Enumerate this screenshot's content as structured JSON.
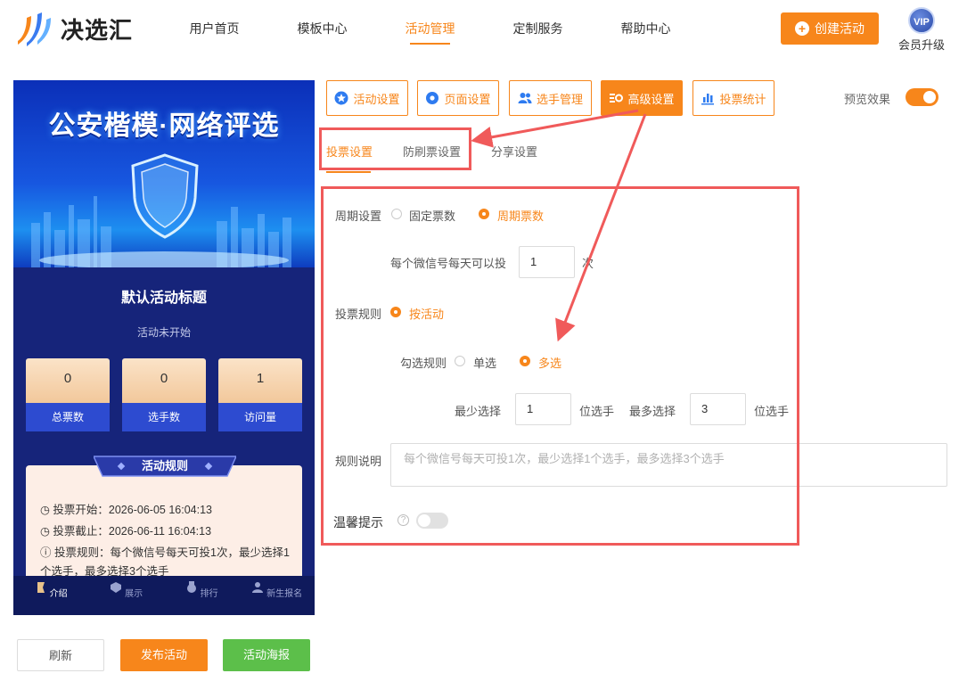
{
  "brand": {
    "name": "决选汇"
  },
  "nav": {
    "items": [
      {
        "label": "用户首页"
      },
      {
        "label": "模板中心"
      },
      {
        "label": "活动管理"
      },
      {
        "label": "定制服务"
      },
      {
        "label": "帮助中心"
      }
    ],
    "active_index": 2
  },
  "header": {
    "create_label": "创建活动",
    "vip_badge": "VIP",
    "vip_label": "会员升级"
  },
  "preview": {
    "banner_title": "公安楷模·网络评选",
    "activity_title": "默认活动标题",
    "status": "活动未开始",
    "stats": [
      {
        "value": "0",
        "label": "总票数"
      },
      {
        "value": "0",
        "label": "选手数"
      },
      {
        "value": "1",
        "label": "访问量"
      }
    ],
    "rules_title": "活动规则",
    "rules": [
      {
        "icon": "clock-icon",
        "text": "投票开始：2026-06-05 16:04:13"
      },
      {
        "icon": "clock-icon",
        "text": "投票截止：2026-06-11 16:04:13"
      },
      {
        "icon": "info-icon",
        "text": "投票规则：每个微信号每天可投1次，最少选择1个选手，最多选择3个选手"
      }
    ],
    "tabs": [
      {
        "label": "介绍"
      },
      {
        "label": "展示"
      },
      {
        "label": "排行"
      },
      {
        "label": "新生报名"
      }
    ]
  },
  "actions": {
    "refresh": "刷新",
    "publish": "发布活动",
    "poster": "活动海报"
  },
  "settings_tabs": [
    {
      "label": "活动设置",
      "icon": "star-icon"
    },
    {
      "label": "页面设置",
      "icon": "gear-icon"
    },
    {
      "label": "选手管理",
      "icon": "users-icon"
    },
    {
      "label": "高级设置",
      "icon": "advanced-settings-icon"
    },
    {
      "label": "投票统计",
      "icon": "bar-chart-icon"
    }
  ],
  "preview_toggle": {
    "label": "预览效果",
    "on": true
  },
  "sub_tabs": [
    {
      "label": "投票设置"
    },
    {
      "label": "防刷票设置"
    },
    {
      "label": "分享设置"
    }
  ],
  "form": {
    "period": {
      "label": "周期设置",
      "options": [
        "固定票数",
        "周期票数"
      ],
      "selected": "周期票数"
    },
    "daily": {
      "label": "每个微信号每天可以投",
      "value": "1",
      "unit": "次"
    },
    "vote_rule": {
      "label": "投票规则",
      "options": [
        "按活动"
      ],
      "selected": "按活动"
    },
    "check_rule": {
      "label": "勾选规则",
      "options": [
        "单选",
        "多选"
      ],
      "selected": "多选"
    },
    "min": {
      "label": "最少选择",
      "value": "1",
      "unit": "位选手"
    },
    "max": {
      "label": "最多选择",
      "value": "3",
      "unit": "位选手"
    },
    "rule_desc": {
      "label": "规则说明",
      "placeholder": "每个微信号每天可投1次，最少选择1个选手，最多选择3个选手"
    },
    "tip": {
      "label": "温馨提示",
      "on": false
    }
  },
  "colors": {
    "accent": "#f7861b",
    "annotation": "#f05a5a",
    "preview_bg": "#16247a"
  }
}
